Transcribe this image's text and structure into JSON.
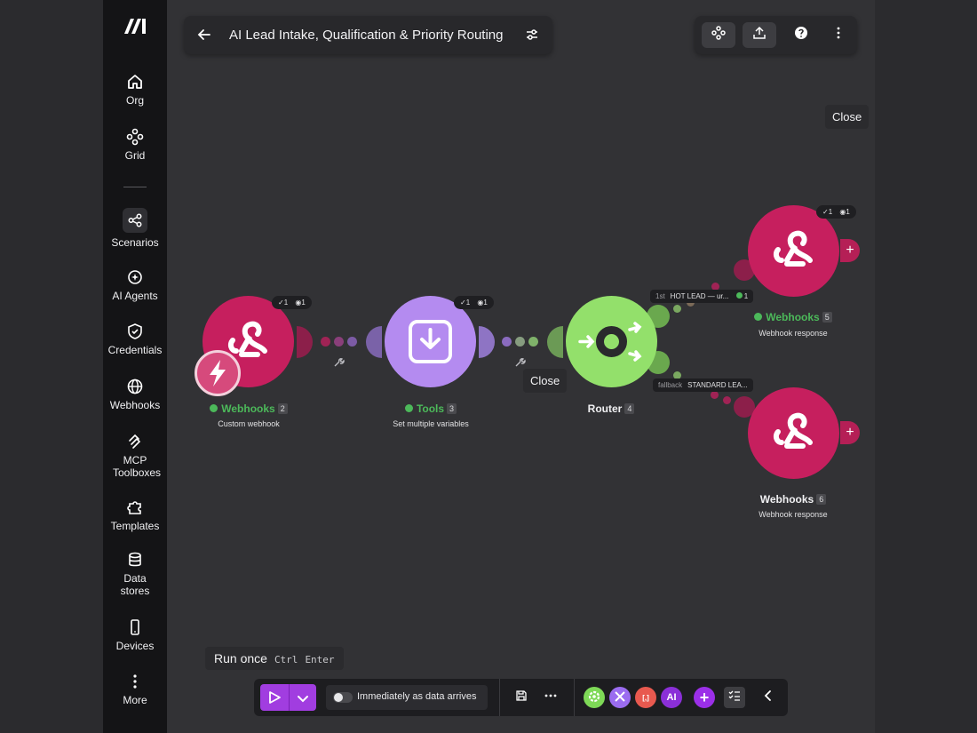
{
  "sidebar": {
    "items": [
      {
        "label": "Org",
        "icon": "home-icon"
      },
      {
        "label": "Grid",
        "icon": "grid-icon"
      },
      {
        "label": "Scenarios",
        "icon": "scenarios-icon"
      },
      {
        "label": "AI Agents",
        "icon": "ai-agents-icon"
      },
      {
        "label": "Credentials",
        "icon": "shield-icon"
      },
      {
        "label": "Webhooks",
        "icon": "globe-icon"
      },
      {
        "label": "MCP Toolboxes",
        "icon": "mcp-icon"
      },
      {
        "label": "Templates",
        "icon": "puzzle-icon"
      },
      {
        "label": "Data stores",
        "icon": "database-icon"
      },
      {
        "label": "Devices",
        "icon": "mobile-icon"
      },
      {
        "label": "More",
        "icon": "more-vertical-icon"
      }
    ]
  },
  "header": {
    "title": "AI Lead Intake, Qualification & Priority Routing"
  },
  "tooltips": {
    "close_top": "Close",
    "close_mid": "Close"
  },
  "modules": {
    "webhook_trigger": {
      "name": "Webhooks",
      "id": "2",
      "sub": "Custom webhook",
      "ops": "1",
      "bundles": "1"
    },
    "tools": {
      "name": "Tools",
      "id": "3",
      "sub": "Set multiple variables",
      "ops": "1",
      "bundles": "1"
    },
    "router": {
      "name": "Router",
      "id": "4"
    },
    "webhook_resp_top": {
      "name": "Webhooks",
      "id": "5",
      "sub": "Webhook response",
      "ops": "1",
      "bundles": "1"
    },
    "webhook_resp_bottom": {
      "name": "Webhooks",
      "id": "6",
      "sub": "Webhook response"
    }
  },
  "routes": {
    "first": {
      "tag": "1st",
      "label": "HOT LEAD — ur...",
      "count": "1"
    },
    "fallback": {
      "tag": "fallback",
      "label": "STANDARD LEA..."
    }
  },
  "bottom": {
    "run_once": "Run once",
    "shortcut_ctrl": "Ctrl",
    "shortcut_enter": "Enter",
    "schedule_label": "Immediately as data arrives",
    "app_buttons": [
      {
        "label": "",
        "color": "#7ed957"
      },
      {
        "label": "",
        "color": "#9b6cf0"
      },
      {
        "label": "[,]",
        "color": "#e8594f"
      },
      {
        "label": "AI",
        "color": "#8b2fd8"
      },
      {
        "label": "+",
        "color": "#9b2fe8"
      }
    ]
  },
  "colors": {
    "webhook": "#c61f5e",
    "tools": "#b48bf0",
    "router": "#93e06b",
    "accent": "#a13de0",
    "success": "#4cb95a"
  }
}
